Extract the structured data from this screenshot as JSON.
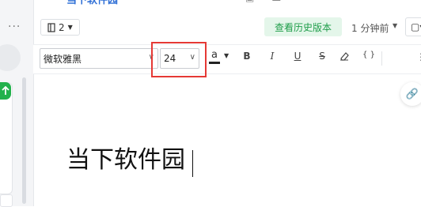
{
  "top": {
    "doc_title": "当下软件园"
  },
  "sidebar": {
    "more": "···"
  },
  "header": {
    "page_number": "2",
    "history_button": "查看历史版本",
    "last_saved": "1 分钟前",
    "panel_button": "▢▾"
  },
  "toolbar": {
    "font_family": "微软雅黑",
    "font_size": "24",
    "color_letter": "a",
    "bold": "B",
    "italic": "I",
    "underline": "U",
    "strike": "S",
    "code": "{ }",
    "more": "⋮⋮"
  },
  "document": {
    "text": "当下软件园"
  },
  "colors": {
    "accent_green": "#22b14c",
    "highlight_red": "#e53935",
    "history_bg": "#e4f6ea"
  }
}
